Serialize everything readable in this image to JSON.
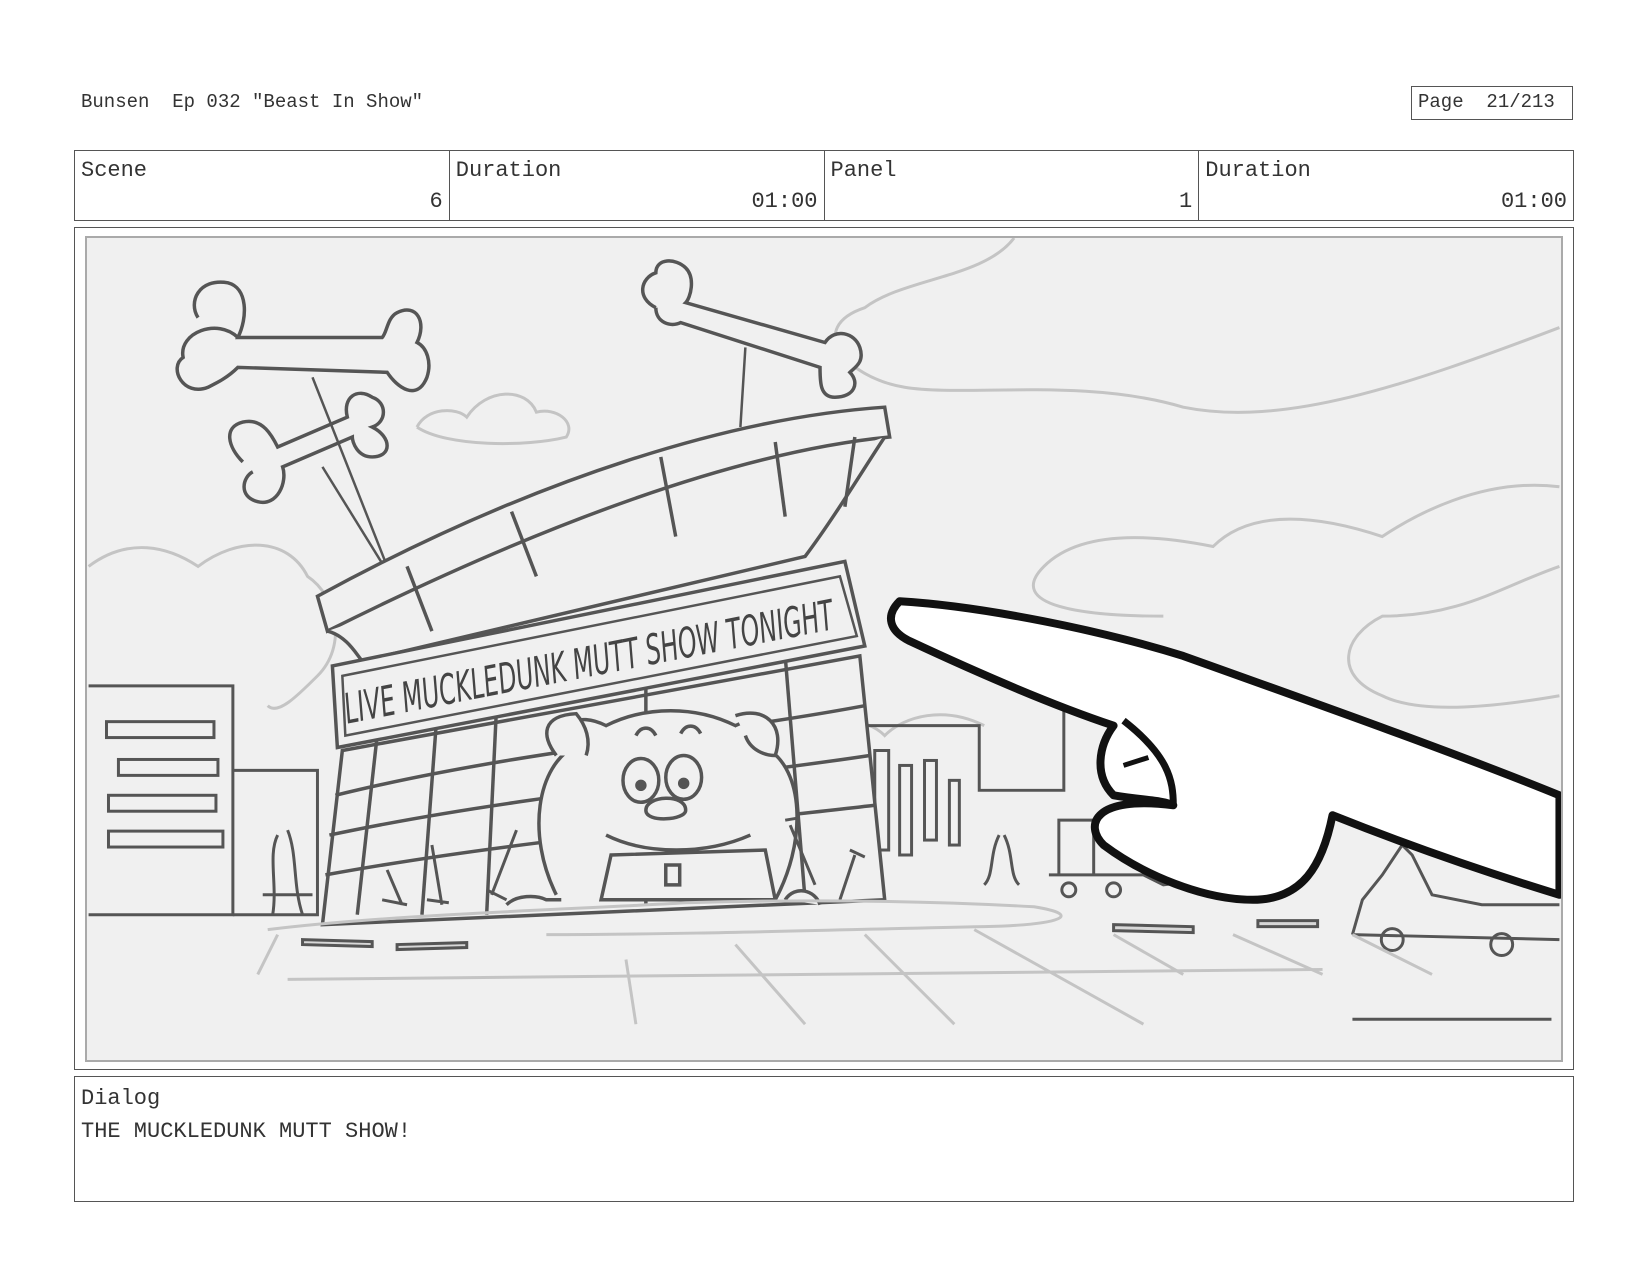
{
  "header": {
    "title": "Bunsen  Ep 032 \"Beast In Show\"",
    "page_label": "Page  21/213"
  },
  "info": {
    "scene_label": "Scene",
    "scene_value": "6",
    "scene_duration_label": "Duration",
    "scene_duration_value": "01:00",
    "panel_label": "Panel",
    "panel_value": "1",
    "panel_duration_label": "Duration",
    "panel_duration_value": "01:00"
  },
  "panel": {
    "sign_text": "LIVE MUCKLEDUNK MUTT SHOW TONIGHT"
  },
  "dialog": {
    "label": "Dialog",
    "text": "THE MUCKLEDUNK MUTT SHOW!"
  }
}
